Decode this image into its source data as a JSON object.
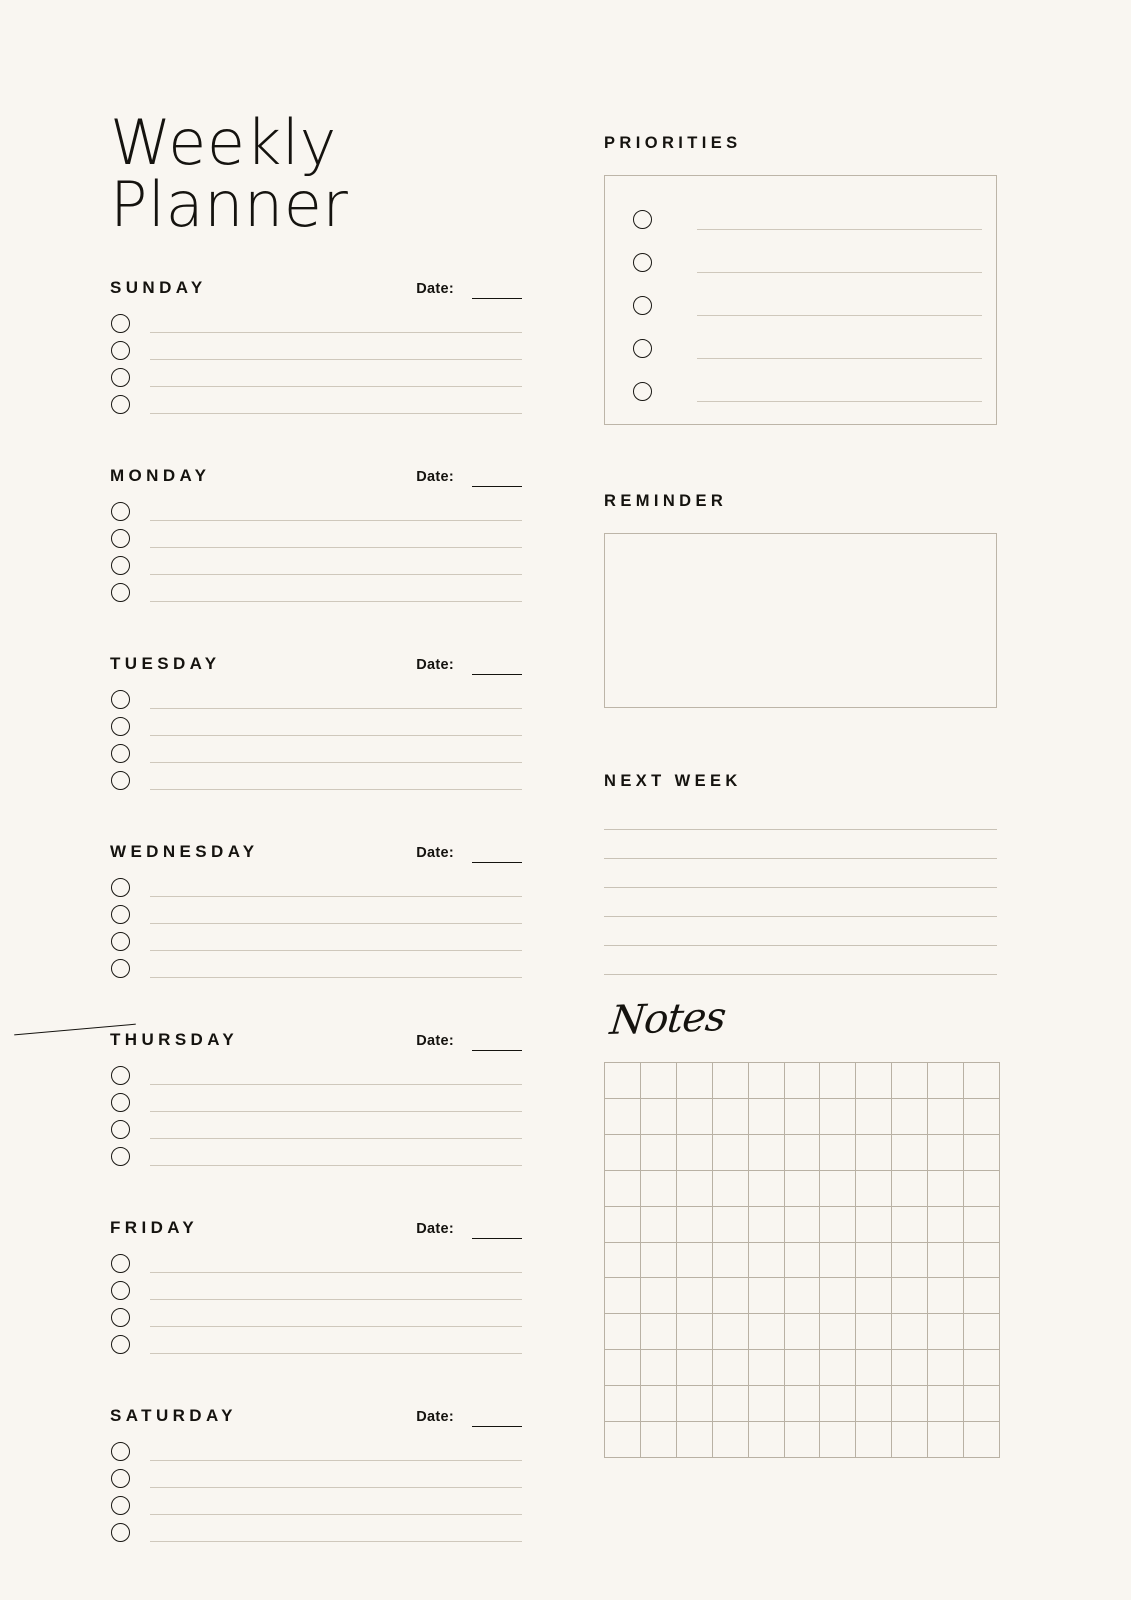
{
  "page": {
    "background_color": "#F9F6F1",
    "ink_color": "#15130F",
    "rule_color": "#CFC8BC",
    "box_border_color": "#BDB5A8"
  },
  "title": "Weekly Planner",
  "date_label": "Date:",
  "days": [
    {
      "name": "SUNDAY",
      "date_value": "",
      "tasks": [
        "",
        "",
        "",
        ""
      ]
    },
    {
      "name": "MONDAY",
      "date_value": "",
      "tasks": [
        "",
        "",
        "",
        ""
      ]
    },
    {
      "name": "TUESDAY",
      "date_value": "",
      "tasks": [
        "",
        "",
        "",
        ""
      ]
    },
    {
      "name": "WEDNESDAY",
      "date_value": "",
      "tasks": [
        "",
        "",
        "",
        ""
      ]
    },
    {
      "name": "THURSDAY",
      "date_value": "",
      "tasks": [
        "",
        "",
        "",
        ""
      ]
    },
    {
      "name": "FRIDAY",
      "date_value": "",
      "tasks": [
        "",
        "",
        "",
        ""
      ]
    },
    {
      "name": "SATURDAY",
      "date_value": "",
      "tasks": [
        "",
        "",
        "",
        ""
      ]
    }
  ],
  "priorities": {
    "title": "PRIORITIES",
    "items": [
      "",
      "",
      "",
      "",
      ""
    ]
  },
  "reminder": {
    "title": "REMINDER",
    "value": ""
  },
  "next_week": {
    "title": "NEXT WEEK",
    "lines": [
      "",
      "",
      "",
      "",
      "",
      ""
    ]
  },
  "notes": {
    "title": "Notes",
    "grid_columns": 11,
    "grid_rows": 11
  }
}
